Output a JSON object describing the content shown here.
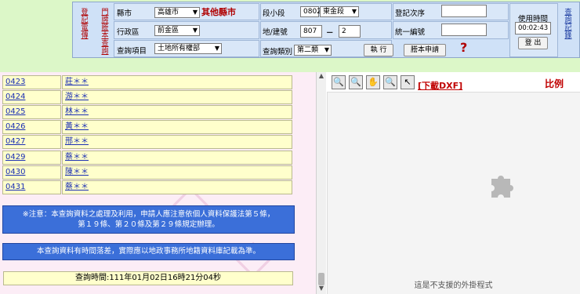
{
  "top": {
    "left_links": [
      "登記電傳",
      "門牌謄本查詢"
    ],
    "right_link": "查詢記錄",
    "city_label": "縣市",
    "city_value": "高雄市",
    "other_city_title": "其他縣市",
    "district_label": "行政區",
    "district_value": "前金區",
    "query_item_label": "查詢項目",
    "query_item_value": "土地所有權部",
    "section_label": "段小段",
    "section_code": "0802",
    "section_name": "東金段",
    "lot_label": "地/建號",
    "lot_main": "807",
    "lot_dash": "－",
    "lot_sub": "2",
    "query_type_label": "查詢類別",
    "query_type_value": "第二類",
    "execute_button": "執 行",
    "transcript_button": "謄本申請",
    "help_icon_glyph": "?",
    "reg_order_label": "登記次序",
    "unified_no_label": "統一編號",
    "usage_time_label": "使用時間",
    "usage_time_value": "00:02:43",
    "logout_button": "登 出"
  },
  "list": {
    "rows": [
      {
        "no": "0423",
        "name": "莊＊＊"
      },
      {
        "no": "0424",
        "name": "游＊＊"
      },
      {
        "no": "0425",
        "name": "林＊＊"
      },
      {
        "no": "0426",
        "name": "黃＊＊"
      },
      {
        "no": "0427",
        "name": "邢＊＊"
      },
      {
        "no": "0429",
        "name": "蔡＊＊"
      },
      {
        "no": "0430",
        "name": "陳＊＊"
      },
      {
        "no": "0431",
        "name": "蔡＊＊"
      }
    ],
    "notice1_line1": "※注意：本查詢資料之處理及利用，申請人應注意依個人資料保護法第５條，",
    "notice1_line2": "第１９條、第２０條及第２９條規定辦理。",
    "notice2": "本查詢資料有時間落差，實際應以地政事務所地籍資料庫記載為準。",
    "query_time": "查詢時間:111年01月02日16時21分04秒"
  },
  "map": {
    "tools": [
      "zoom-in",
      "zoom-out",
      "pan",
      "zoom-box",
      "select"
    ],
    "dxf_link": "[下載DXF]",
    "scale_label": "比例尺：",
    "plugin_message": "這是不支援的外掛程式"
  }
}
